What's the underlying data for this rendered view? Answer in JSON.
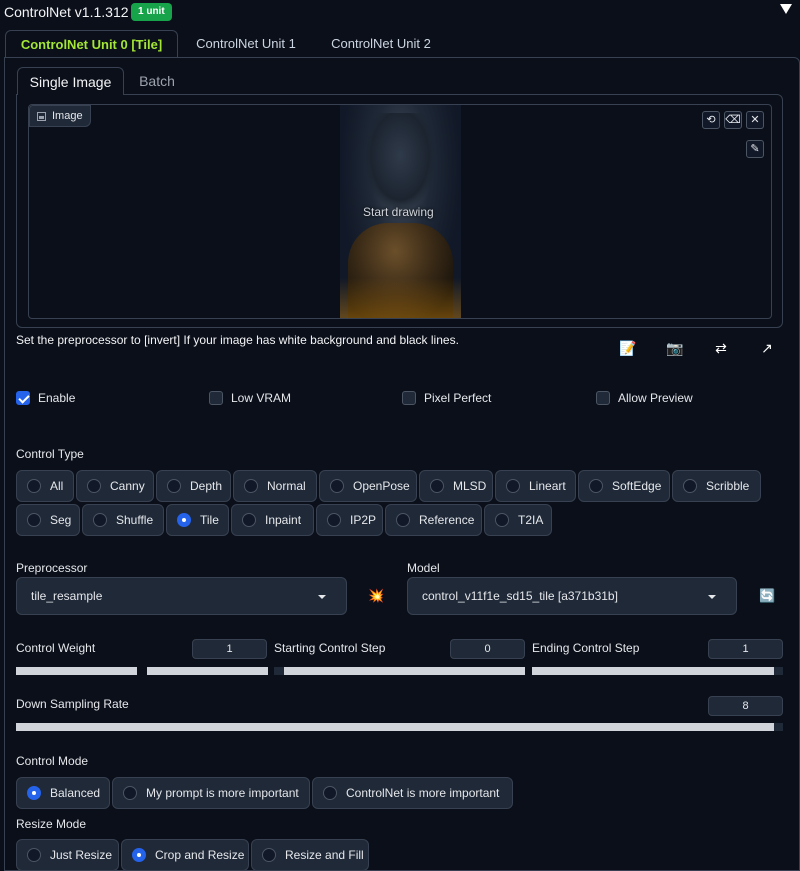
{
  "header": {
    "title": "ControlNet v1.1.312",
    "badge": "1 unit"
  },
  "unit_tabs": [
    {
      "label": "ControlNet Unit 0 [Tile]",
      "active": true
    },
    {
      "label": "ControlNet Unit 1",
      "active": false
    },
    {
      "label": "ControlNet Unit 2",
      "active": false
    }
  ],
  "image_tabs": [
    {
      "label": "Single Image",
      "active": true
    },
    {
      "label": "Batch",
      "active": false
    }
  ],
  "canvas": {
    "label": "Image",
    "overlay_text": "Start drawing",
    "tools": {
      "undo": "⟲",
      "erase": "⌫",
      "close": "✕",
      "brush": "✎"
    }
  },
  "hint": "Set the preprocessor to [invert] If your image has white background and black lines.",
  "actions": {
    "notes": "📝",
    "camera": "📷",
    "swap": "⇄",
    "send": "↗"
  },
  "options": [
    {
      "label": "Enable",
      "checked": true
    },
    {
      "label": "Low VRAM",
      "checked": false
    },
    {
      "label": "Pixel Perfect",
      "checked": false
    },
    {
      "label": "Allow Preview",
      "checked": false
    }
  ],
  "control_type": {
    "label": "Control Type",
    "selected": "Tile",
    "items": [
      "All",
      "Canny",
      "Depth",
      "Normal",
      "OpenPose",
      "MLSD",
      "Lineart",
      "SoftEdge",
      "Scribble",
      "Seg",
      "Shuffle",
      "Tile",
      "Inpaint",
      "IP2P",
      "Reference",
      "T2IA"
    ]
  },
  "preprocessor": {
    "label": "Preprocessor",
    "value": "tile_resample",
    "run_icon": "💥"
  },
  "model": {
    "label": "Model",
    "value": "control_v11f1e_sd15_tile [a371b31b]",
    "refresh_icon": "🔄"
  },
  "sliders": {
    "control_weight": {
      "label": "Control Weight",
      "value": "1",
      "fraction": 0.5
    },
    "starting_step": {
      "label": "Starting Control Step",
      "value": "0",
      "fraction": 0.0
    },
    "ending_step": {
      "label": "Ending Control Step",
      "value": "1",
      "fraction": 1.0
    },
    "down_sampling": {
      "label": "Down Sampling Rate",
      "value": "8",
      "fraction": 1.0
    }
  },
  "control_mode": {
    "label": "Control Mode",
    "selected": "Balanced",
    "items": [
      "Balanced",
      "My prompt is more important",
      "ControlNet is more important"
    ]
  },
  "resize_mode": {
    "label": "Resize Mode",
    "selected": "Crop and Resize",
    "items": [
      "Just Resize",
      "Crop and Resize",
      "Resize and Fill"
    ]
  }
}
